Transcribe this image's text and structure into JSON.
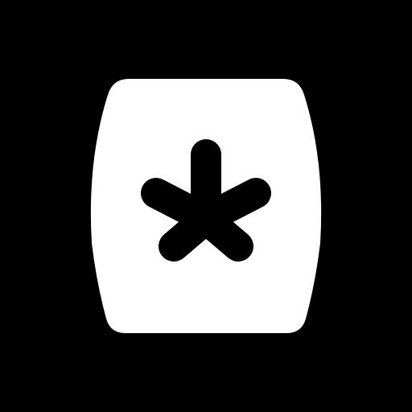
{
  "icon": {
    "name": "barrel-asterisk-icon",
    "foreground_color": "#ffffff",
    "background_color": "#000000",
    "symbol_color": "#000000"
  }
}
